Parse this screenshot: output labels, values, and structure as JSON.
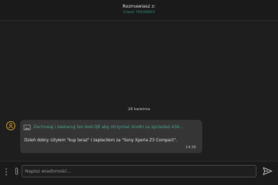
{
  "header": {
    "title": "Rozmawiasz z:",
    "client": "Client 76599803"
  },
  "chat": {
    "date_separator": "28 kwietnia",
    "message": {
      "attachment_text": "Zachowaj i zeskanuj ten kod-QR aby otrzymać środki za sprzedaż.434...",
      "text": "Dzień dobry. Użyłem \"kup teraz\" i zapłaciłem za \"Sony Xperia Z3 Compact\".",
      "time": "14:36"
    }
  },
  "input": {
    "placeholder": "Napisz wiadomość..."
  },
  "colors": {
    "accent": "#4aa58f",
    "avatar_ring": "#e0a52a"
  },
  "icons": [
    "user-icon",
    "image-icon",
    "more-options-icon",
    "paperclip-icon",
    "send-icon"
  ]
}
